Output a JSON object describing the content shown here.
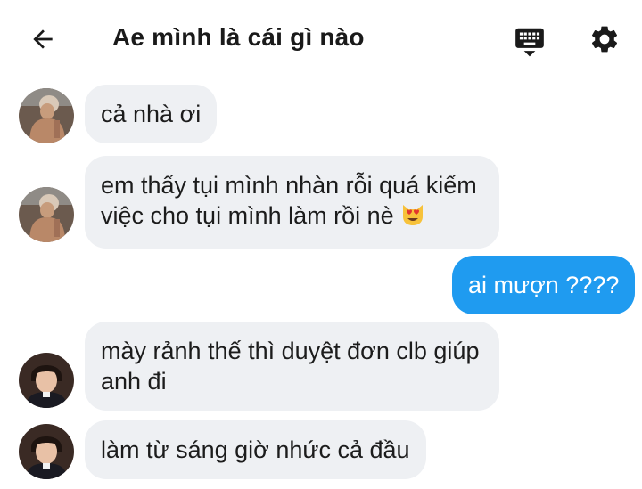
{
  "header": {
    "title": "Ae mình là cái gì nào",
    "back_icon": "arrow-left-icon",
    "keyboard_icon": "keyboard-icon",
    "settings_icon": "gear-icon"
  },
  "messages": [
    {
      "sender": "other",
      "text": "cả nhà ơi"
    },
    {
      "sender": "other",
      "line1": "em thấy tụi mình nhàn rỗi quá kiếm",
      "line2": "việc cho tụi mình làm rồi nè",
      "emoji": "smiling-cat-heart-eyes-emoji"
    },
    {
      "sender": "me",
      "text": "ai mượn ????"
    },
    {
      "sender": "other",
      "line1": "mày rảnh thế thì duyệt đơn clb giúp",
      "line2": "anh đi"
    },
    {
      "sender": "other",
      "text": "làm từ sáng giờ nhức cả đầu"
    }
  ],
  "colors": {
    "incoming_bubble": "#eef0f3",
    "outgoing_bubble": "#1f9bf0",
    "text": "#1c1c1c"
  }
}
